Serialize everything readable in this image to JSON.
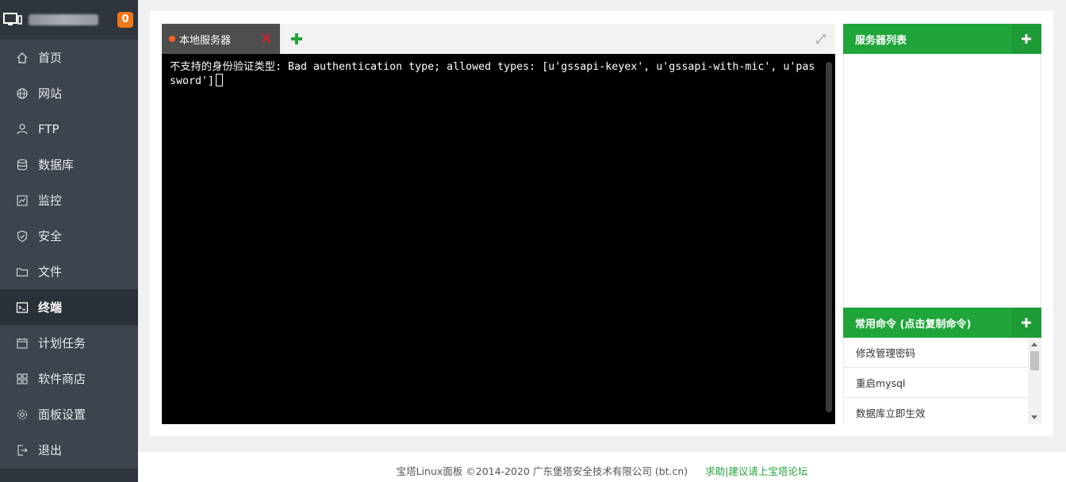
{
  "sidebar": {
    "badge_count": "0",
    "items": [
      {
        "label": "首页",
        "icon": "home-icon"
      },
      {
        "label": "网站",
        "icon": "globe-icon"
      },
      {
        "label": "FTP",
        "icon": "ftp-user-icon"
      },
      {
        "label": "数据库",
        "icon": "database-icon"
      },
      {
        "label": "监控",
        "icon": "monitor-chart-icon"
      },
      {
        "label": "安全",
        "icon": "shield-icon"
      },
      {
        "label": "文件",
        "icon": "folder-icon"
      },
      {
        "label": "终端",
        "icon": "terminal-icon",
        "active": true
      },
      {
        "label": "计划任务",
        "icon": "calendar-icon"
      },
      {
        "label": "软件商店",
        "icon": "grid-icon"
      },
      {
        "label": "面板设置",
        "icon": "gear-icon"
      },
      {
        "label": "退出",
        "icon": "logout-icon"
      }
    ]
  },
  "terminal": {
    "tab_label": "本地服务器",
    "output": "不支持的身份验证类型: Bad authentication type; allowed types: [u'gssapi-keyex', u'gssapi-with-mic', u'password']"
  },
  "server_panel": {
    "title": "服务器列表"
  },
  "command_panel": {
    "title": "常用命令 (点击复制命令)",
    "items": [
      "修改管理密码",
      "重启mysql",
      "数据库立即生效"
    ]
  },
  "footer": {
    "copyright": "宝塔Linux面板 ©2014-2020 广东堡塔安全技术有限公司 (bt.cn)",
    "help_link": "求助|建议请上宝塔论坛"
  },
  "colors": {
    "brand_green": "#20a53a",
    "sidebar_bg": "#3c444d",
    "badge_orange": "#f0761b"
  }
}
